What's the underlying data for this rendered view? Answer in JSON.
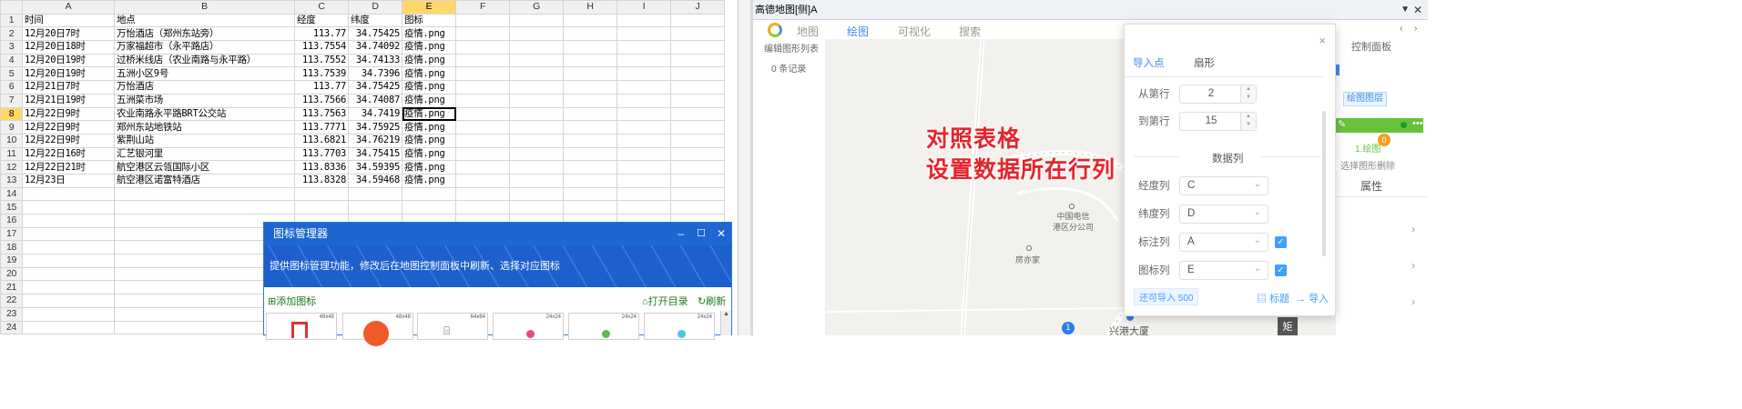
{
  "spreadsheet": {
    "columns": [
      "A",
      "B",
      "C",
      "D",
      "E",
      "F",
      "G",
      "H",
      "I",
      "J"
    ],
    "rows": [
      [
        "时间",
        "地点",
        "经度",
        "纬度",
        "图标"
      ],
      [
        "12月20日7时",
        "万怡酒店（郑州东站旁）",
        "113.77",
        "34.75425",
        "疫情.png"
      ],
      [
        "12月20日18时",
        "万家福超市（永平路店）",
        "113.7554",
        "34.74092",
        "疫情.png"
      ],
      [
        "12月20日19时",
        "过桥米线店（农业南路与永平路）",
        "113.7552",
        "34.74133",
        "疫情.png"
      ],
      [
        "12月20日19时",
        "五洲小区9号",
        "113.7539",
        "34.7396",
        "疫情.png"
      ],
      [
        "12月21日7时",
        "万怡酒店",
        "113.77",
        "34.75425",
        "疫情.png"
      ],
      [
        "12月21日19时",
        "五洲菜市场",
        "113.7566",
        "34.74087",
        "疫情.png"
      ],
      [
        "12月22日9时",
        "农业南路永平路BRT公交站",
        "113.7563",
        "34.7419",
        "疫情.png"
      ],
      [
        "12月22日9时",
        "郑州东站地铁站",
        "113.7771",
        "34.75925",
        "疫情.png"
      ],
      [
        "12月22日9时",
        "紫荆山站",
        "113.6821",
        "34.76219",
        "疫情.png"
      ],
      [
        "12月22日16时",
        "汇艺银河里",
        "113.7703",
        "34.75415",
        "疫情.png"
      ],
      [
        "12月22日21时",
        "航空港区云瓴国际小区",
        "113.8336",
        "34.59395",
        "疫情.png"
      ],
      [
        "12月23日",
        "航空港区诺富特酒店",
        "113.8328",
        "34.59468",
        "疫情.png"
      ]
    ],
    "row_numbers": [
      "1",
      "2",
      "3",
      "4",
      "5",
      "6",
      "7",
      "8",
      "9",
      "10",
      "11",
      "12",
      "13",
      "14",
      "15",
      "16",
      "17",
      "18",
      "19",
      "20",
      "21",
      "22",
      "23",
      "24"
    ]
  },
  "icon_manager": {
    "title": "图标管理器",
    "minimize": "–",
    "maximize": "☐",
    "close": "✕",
    "banner": "提供图标管理功能，修改后在地图控制面板中刷新、选择对应图标",
    "add_icon": "添加图标",
    "open_dir": "打开目录",
    "refresh": "刷新",
    "thumb_sizes": [
      "48x48",
      "48x48",
      "64x64",
      "24x24",
      "24x24",
      "24x24"
    ]
  },
  "map_window": {
    "title": "高德地图[侧]A",
    "nav": [
      "地图",
      "绘图",
      "可视化",
      "搜索"
    ],
    "left_panel_title": "编辑图形列表",
    "left_panel_count": "0 条记录",
    "map_labels": [
      "中国电信",
      "港区分公司",
      "房亦家",
      "兴港大厦"
    ],
    "marker_number": "1",
    "corner_glyph": "矩"
  },
  "overlay": {
    "line1": "对照表格",
    "line2": "设置数据所在行列"
  },
  "import_dialog": {
    "tabs": [
      "导入点",
      "扇形"
    ],
    "from_row_label": "从第行",
    "from_row_value": "2",
    "to_row_label": "到第行",
    "to_row_value": "15",
    "data_col_title": "数据列",
    "lng_label": "经度列",
    "lng_value": "C",
    "lat_label": "纬度列",
    "lat_value": "D",
    "mark_label": "标注列",
    "mark_value": "A",
    "icon_label": "图标列",
    "icon_value": "E",
    "remaining": "还可导入 500",
    "title_btn": "标题",
    "import_btn": "导入",
    "close": "×"
  },
  "control_panel": {
    "title": "控制面板",
    "layer_btn": "绘图图层",
    "layer_item": "1.绘图",
    "badge": "0",
    "select_delete": "选择图形删除",
    "props": "属性"
  }
}
